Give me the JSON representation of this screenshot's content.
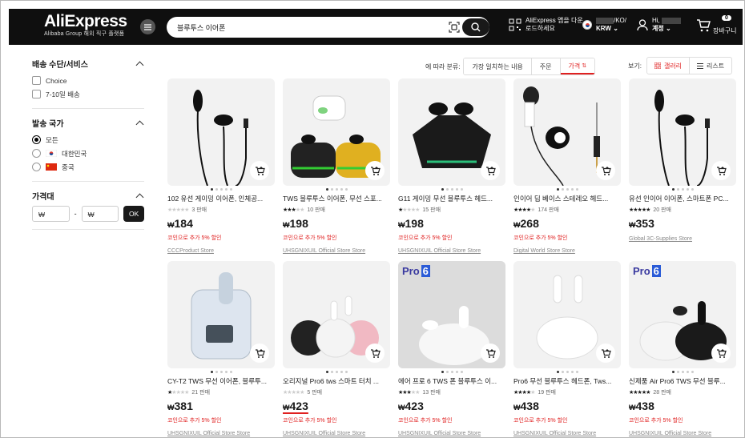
{
  "header": {
    "logo": "AliExpress",
    "logo_sub": "Alibaba Group 해외 직구 플랫폼",
    "search_value": "블루투스 이어폰",
    "app_promo": "AliExpress 앱을 다운로드하세요",
    "locale_top": "/KO/",
    "currency": "KRW",
    "user_greeting": "Hi,",
    "account_label": "계정",
    "cart_count": "0",
    "cart_label": "장바구니"
  },
  "sidebar": {
    "shipping_title": "배송 수단/서비스",
    "shipping_options": [
      "Choice",
      "7-10일 배송"
    ],
    "country_title": "발송 국가",
    "country_options": [
      "모든",
      "대한민국",
      "중국"
    ],
    "price_title": "가격대",
    "price_min_placeholder": "₩",
    "price_sep": "-",
    "price_max_placeholder": "₩",
    "ok_label": "OK"
  },
  "sortbar": {
    "label": "에 따라 분류:",
    "options": [
      "가장 일치하는 내용",
      "주문",
      "가격"
    ],
    "view_label": "보기:",
    "gallery": "갤러리",
    "list": "리스트"
  },
  "products": [
    {
      "title": "102 유선 게이밍 이어폰, 인체공...",
      "sold": "3 판매",
      "price": "184",
      "promo": "코인으로 추가 5% 할인",
      "store": "CCCProduct Store",
      "stars": 0
    },
    {
      "title": "TWS 블루투스 이어폰, 무선 스포...",
      "sold": "10 판매",
      "price": "198",
      "promo": "코인으로 추가 5% 할인",
      "store": "UHSGNIXUIL Official Store Store",
      "stars": 3
    },
    {
      "title": "G11 게이밍 무선 블루투스 헤드...",
      "sold": "15 판매",
      "price": "198",
      "promo": "코인으로 추가 5% 할인",
      "store": "UHSGNIXUIL Official Store Store",
      "stars": 1
    },
    {
      "title": "인이어 딥 베이스 스테레오 헤드...",
      "sold": "174 판매",
      "price": "268",
      "promo": "코인으로 추가 5% 할인",
      "store": "Digital World Store Store",
      "stars": 4
    },
    {
      "title": "유선 인이어 이어폰, 스마트폰 PC...",
      "sold": "20 판매",
      "price": "353",
      "promo": "",
      "store": "Global 3C-Supplies Store",
      "stars": 5
    },
    {
      "title": "CY-T2 TWS 무선 이어폰, 블루투...",
      "sold": "21 판매",
      "price": "381",
      "promo": "코인으로 추가 5% 할인",
      "store": "UHSGNIXUIL Official Store Store",
      "stars": 1
    },
    {
      "title": "오리지널 Pro6 tws 스마트 터치 ...",
      "sold": "5 판매",
      "price": "423",
      "promo": "코인으로 추가 5% 할인",
      "store": "UHSGNIXUIL Official Store Store",
      "stars": 0
    },
    {
      "title": "에어 프로 6 TWS 폰 블루투스 이...",
      "sold": "13 판매",
      "price": "423",
      "promo": "코인으로 추가 5% 할인",
      "store": "UHSGNIXUIL Official Store Store",
      "stars": 3
    },
    {
      "title": "Pro6 무선 블루투스 헤드폰, Tws...",
      "sold": "19 판매",
      "price": "438",
      "promo": "코인으로 추가 5% 할인",
      "store": "UHSGNIXUIL Official Store Store",
      "stars": 4
    },
    {
      "title": "신제품 Air Pro6 TWS 무선 블루...",
      "sold": "28 판매",
      "price": "438",
      "promo": "코인으로 추가 5% 할인",
      "store": "UHSGNIXUIL Official Store Store",
      "stars": 5
    }
  ],
  "currency_symbol": "₩",
  "badge_text": "Pro",
  "badge_num": "6"
}
